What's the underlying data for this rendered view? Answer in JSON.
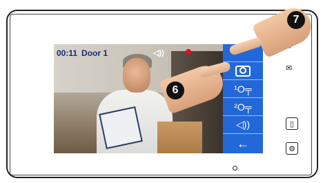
{
  "hud": {
    "time": "00:11",
    "door": "Door 1",
    "speaker_icon": "speaker-icon",
    "record_color": "#e01020"
  },
  "menu": {
    "items": [
      {
        "name": "menu-top",
        "label": "",
        "icon": "top-icon"
      },
      {
        "name": "camera",
        "label": "◎",
        "icon": "camera-icon"
      },
      {
        "name": "unlock-1",
        "label": "¹O╤",
        "icon": "key-icon"
      },
      {
        "name": "unlock-2",
        "label": "²O╤",
        "icon": "key-icon"
      },
      {
        "name": "volume",
        "label": "◁))",
        "icon": "volume-icon"
      },
      {
        "name": "back",
        "label": "←",
        "icon": "back-arrow-icon"
      }
    ],
    "accent": "#2268d8"
  },
  "side_buttons": [
    {
      "name": "monitor-button",
      "glyph": "▯"
    },
    {
      "name": "settings-button",
      "glyph": "⚙"
    }
  ],
  "badges": [
    "6",
    "7"
  ]
}
